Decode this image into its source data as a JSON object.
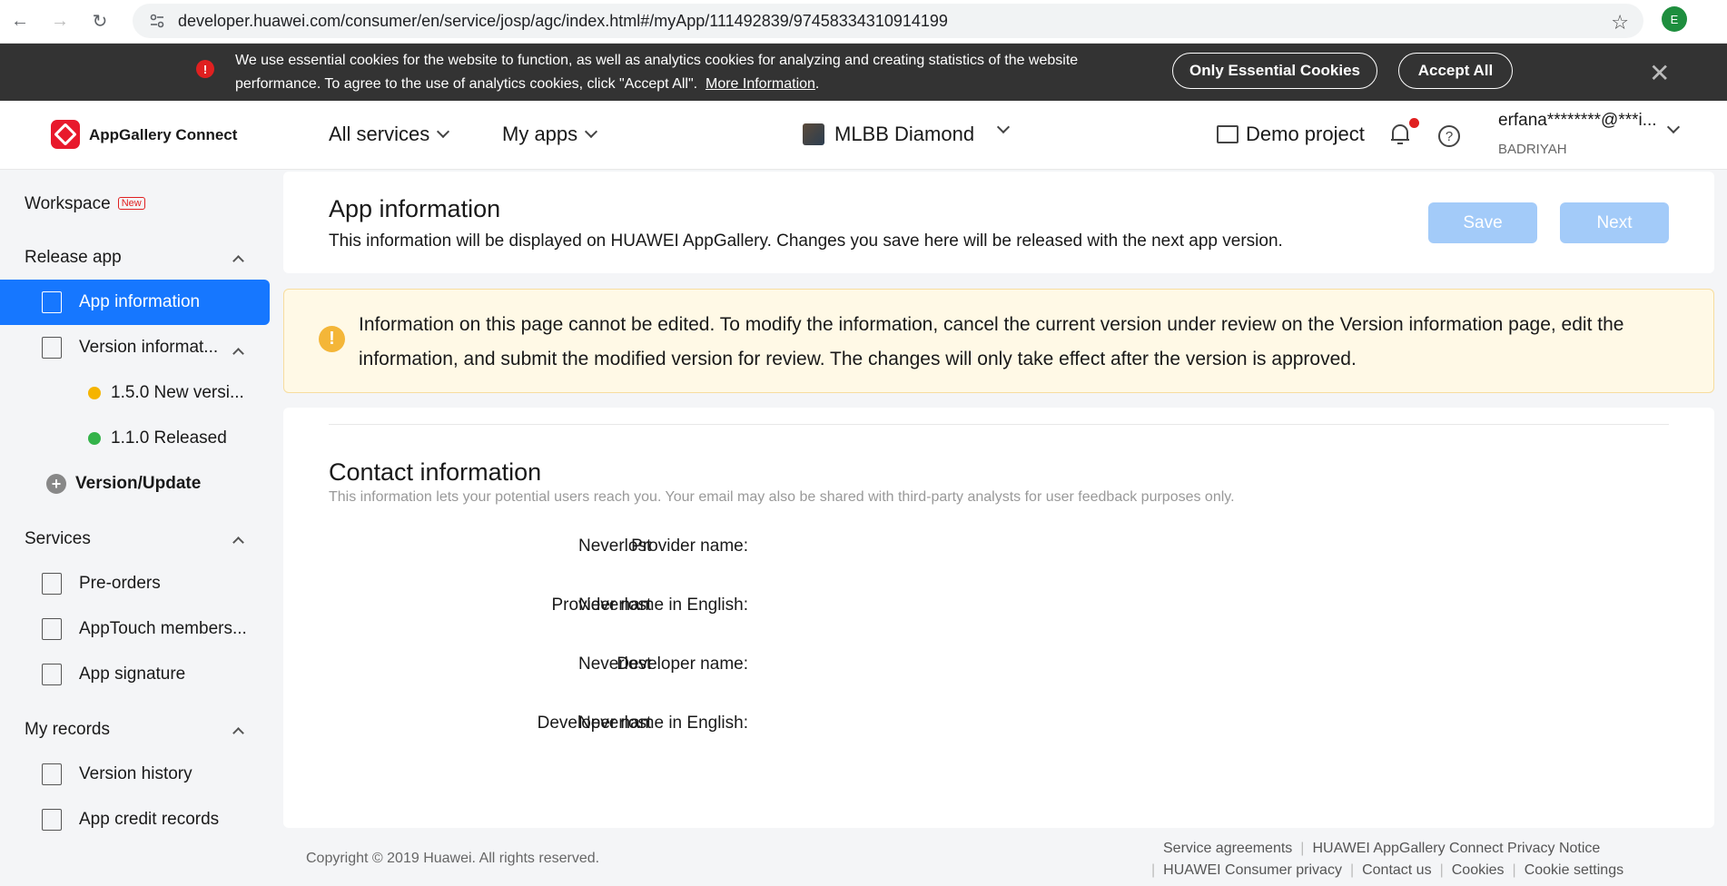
{
  "browser": {
    "url": "developer.huawei.com/consumer/en/service/josp/agc/index.html#/myApp/111492839/97458334310914199",
    "profile_initial": "E"
  },
  "cookie": {
    "text": "We use essential cookies for the website to function, as well as analytics cookies for analyzing and creating statistics of the website performance. To agree to the use of analytics cookies, click \"Accept All\".",
    "more_link": "More Information",
    "essential_label": "Only Essential Cookies",
    "accept_label": "Accept All"
  },
  "header": {
    "logo_text": "AppGallery Connect",
    "all_services": "All services",
    "my_apps": "My apps",
    "app_name": "MLBB Diamond",
    "demo_project": "Demo project",
    "user_email": "erfana********@***i...",
    "user_name": "BADRIYAH"
  },
  "sidebar": {
    "workspace": "Workspace",
    "workspace_badge": "New",
    "release_app": "Release app",
    "app_information": "App information",
    "version_information": "Version informat...",
    "version_150": "1.5.0 New versi...",
    "version_110": "1.1.0 Released",
    "version_update": "Version/Update",
    "services": "Services",
    "pre_orders": "Pre-orders",
    "apptouch": "AppTouch members...",
    "app_signature": "App signature",
    "my_records": "My records",
    "version_history": "Version history",
    "app_credit": "App credit records"
  },
  "main": {
    "title": "App information",
    "subtitle": "This information will be displayed on HUAWEI AppGallery. Changes you save here will be released with the next app version.",
    "save_label": "Save",
    "next_label": "Next",
    "alert_text": "Information on this page cannot be edited. To modify the information, cancel the current version under review on the Version information page, edit the information, and submit the modified version for review. The changes will only take effect after the version is approved.",
    "contact_title": "Contact information",
    "contact_sub": "This information lets your potential users reach you. Your email may also be shared with third-party analysts for user feedback purposes only.",
    "fields": [
      {
        "label": "Provider name:",
        "value": "Neverlost"
      },
      {
        "label": "Provider name in English:",
        "value": "Neverlost"
      },
      {
        "label": "Developer name:",
        "value": "Neverlost"
      },
      {
        "label": "Developer name in English:",
        "value": "Neverlost"
      }
    ]
  },
  "footer": {
    "copyright": "Copyright © 2019 Huawei. All rights reserved.",
    "service_agreements": "Service agreements",
    "privacy_notice": "HUAWEI AppGallery Connect Privacy Notice",
    "consumer_privacy": "HUAWEI Consumer privacy",
    "contact_us": "Contact us",
    "cookies": "Cookies",
    "cookie_settings": "Cookie settings"
  },
  "colors": {
    "primary": "#1677ff",
    "primary_disabled": "#a3cbf9",
    "alert_bg": "#fff9e6",
    "status_pending": "#f5b400",
    "status_released": "#34b34a"
  },
  "icons": [
    "back-icon",
    "forward-icon",
    "reload-icon",
    "site-settings-icon",
    "star-icon",
    "warning-icon",
    "close-icon",
    "bell-icon",
    "help-icon",
    "project-icon",
    "plus-icon"
  ]
}
